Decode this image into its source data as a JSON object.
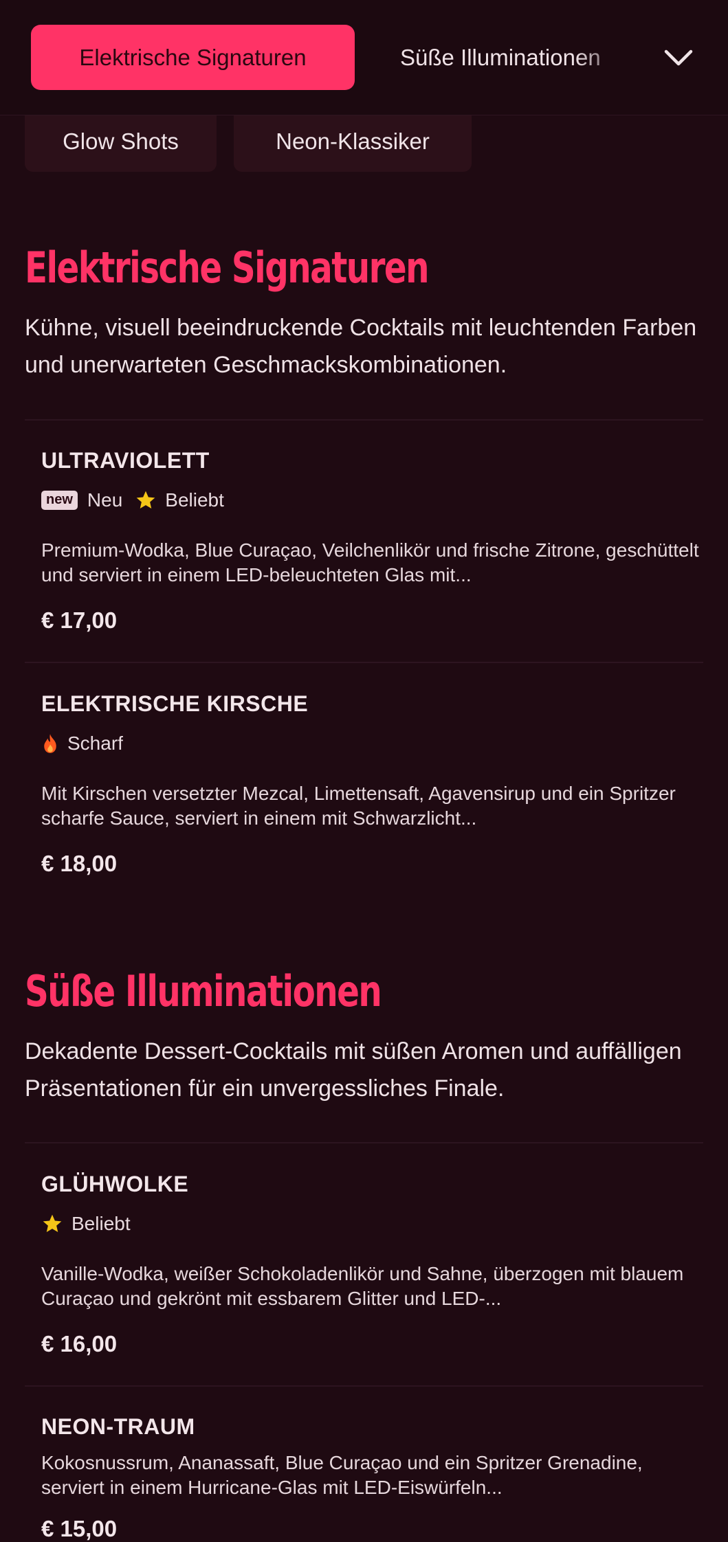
{
  "nav": {
    "active_category": "Elektrische Signaturen",
    "next_category": "Süße Illuminationen",
    "expand_icon": "chevron-down-icon"
  },
  "sub_categories": [
    "Glow Shots",
    "Neon-Klassiker"
  ],
  "sections": [
    {
      "title": "Elektrische Signaturen",
      "description": "Kühne, visuell beeindruckende Cocktails mit leuchtenden Farben und unerwarteten Geschmackskombinationen.",
      "items": [
        {
          "name": "ULTRAVIOLETT",
          "badge": "new",
          "tags": [
            "Neu",
            "Beliebt"
          ],
          "description": "Premium-Wodka, Blue Curaçao, Veilchenlikör und frische Zitrone, geschüttelt und serviert in einem LED-beleuchteten Glas mit...",
          "price": "€ 17,00"
        },
        {
          "name": "ELEKTRISCHE KIRSCHE",
          "tags": [
            "Scharf"
          ],
          "description": "Mit Kirschen versetzter Mezcal, Limettensaft, Agavensirup und ein Spritzer scharfe Sauce, serviert in einem mit Schwarzlicht...",
          "price": "€ 18,00"
        }
      ]
    },
    {
      "title": "Süße Illuminationen",
      "description": "Dekadente Dessert-Cocktails mit süßen Aromen und auffälligen Präsentationen für ein unvergessliches Finale.",
      "items": [
        {
          "name": "GLÜHWOLKE",
          "tags": [
            "Beliebt"
          ],
          "description": "Vanille-Wodka, weißer Schokoladenlikör und Sahne, überzogen mit blauem Curaçao und gekrönt mit essbarem Glitter und LED-...",
          "price": "€ 16,00"
        },
        {
          "name": "NEON-TRAUM",
          "tags": [],
          "description": "Kokosnussrum, Ananassaft, Blue Curaçao und ein Spritzer Grenadine, serviert in einem Hurricane-Glas mit LED-Eiswürfeln...",
          "price": "€ 15,00"
        }
      ]
    }
  ],
  "colors": {
    "accent": "#ff3366",
    "background": "#1f0a12",
    "star": "#f5c518",
    "flame": "#ff5a1f"
  }
}
